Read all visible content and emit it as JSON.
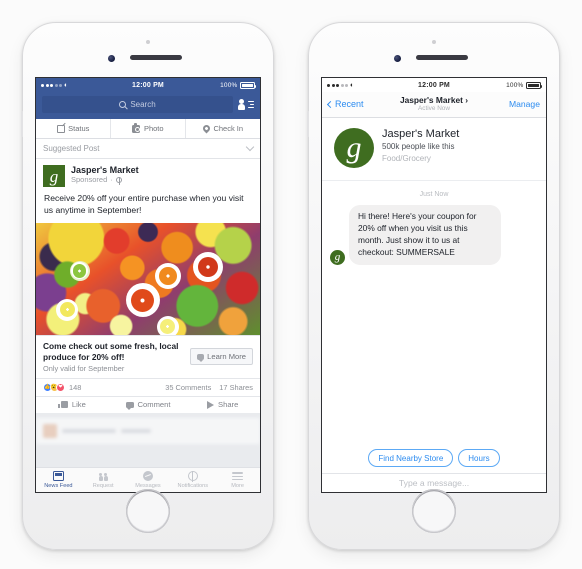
{
  "left_phone": {
    "status_bar": {
      "time": "12:00 PM",
      "battery": "100%",
      "carrier_dots": 5,
      "wifi_icon": "wifi-icon"
    },
    "search": {
      "placeholder": "Search",
      "icon": "search-icon"
    },
    "friends_icon": "friend-requests-icon",
    "composer": [
      {
        "label": "Status",
        "icon": "pencil-icon"
      },
      {
        "label": "Photo",
        "icon": "camera-icon"
      },
      {
        "label": "Check In",
        "icon": "location-pin-icon"
      }
    ],
    "suggested_header": {
      "label": "Suggested Post",
      "icon": "chevron-down-icon"
    },
    "post": {
      "page_name": "Jasper's Market",
      "sponsored": "Sponsored",
      "privacy_icon": "globe-icon",
      "body": "Receive 20% off your entire purchase when you visit us anytime in September!",
      "image_alt": "fresh-fruit-photo",
      "cta_headline": "Come check out some fresh, local produce for 20% off!",
      "cta_sub": "Only valid for September",
      "cta_button": "Learn More",
      "cta_button_icon": "messenger-bubble-icon",
      "reactions": [
        "like",
        "wow",
        "love"
      ],
      "reaction_count": "148",
      "comments": "35 Comments",
      "shares": "17 Shares",
      "actions": [
        {
          "label": "Like",
          "icon": "thumbs-up-icon"
        },
        {
          "label": "Comment",
          "icon": "comment-icon"
        },
        {
          "label": "Share",
          "icon": "share-arrow-icon"
        }
      ]
    },
    "tabbar": [
      {
        "label": "News Feed",
        "icon": "news-feed-icon",
        "active": true
      },
      {
        "label": "Request",
        "icon": "friend-request-icon",
        "active": false
      },
      {
        "label": "Messages",
        "icon": "messenger-icon",
        "active": false
      },
      {
        "label": "Notifications",
        "icon": "globe-notification-icon",
        "active": false
      },
      {
        "label": "More",
        "icon": "hamburger-icon",
        "active": false
      }
    ]
  },
  "right_phone": {
    "status_bar": {
      "time": "12:00 PM",
      "battery": "100%",
      "wifi_icon": "wifi-icon"
    },
    "nav": {
      "back_label": "Recent",
      "back_icon": "chevron-left-icon",
      "title": "Jasper's Market ›",
      "subtitle": "Active Now",
      "action_label": "Manage"
    },
    "profile": {
      "name": "Jasper's Market",
      "likes": "500k people like this",
      "category": "Food/Grocery",
      "avatar_icon": "jaspers-market-logo"
    },
    "thread": {
      "timestamp": "Just Now",
      "message": "Hi there! Here's your coupon for 20% off when you visit us this month. Just show it to us at checkout: SUMMERSALE",
      "avatar_icon": "jaspers-market-logo"
    },
    "quick_replies": [
      "Find Nearby Store",
      "Hours"
    ],
    "input_placeholder": "Type a message..."
  },
  "colors": {
    "facebook_blue": "#3b5998",
    "messenger_blue": "#2d8cf0",
    "brand_green": "#3f6d20",
    "page_background": "#fbfbfb"
  }
}
